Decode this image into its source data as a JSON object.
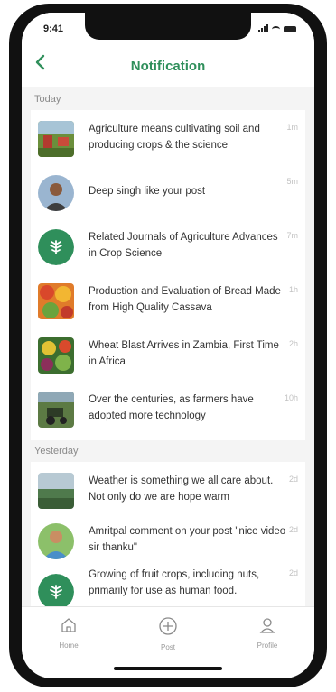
{
  "status_bar": {
    "time": "9:41"
  },
  "header": {
    "back_icon": "chevron-left-icon",
    "title": "Notification"
  },
  "sections": [
    {
      "label": "Today"
    },
    {
      "label": "Yesterday"
    }
  ],
  "notifications": [
    {
      "text": "Agriculture means cultivating soil and producing crops & the science",
      "time": "1m"
    },
    {
      "text": "Deep singh like your post",
      "time": "5m"
    },
    {
      "text": "Related Journals of Agriculture Advances in Crop Science",
      "time": "7m"
    },
    {
      "text": "Production and Evaluation of Bread Made from High Quality Cassava",
      "time": "1h"
    },
    {
      "text": "Wheat Blast Arrives in Zambia, First Time in Africa",
      "time": "2h"
    },
    {
      "text": "Over the centuries, as farmers have adopted more technology",
      "time": "10h"
    },
    {
      "text": "Weather is something we all care about. Not only do we are hope warm",
      "time": "2d"
    },
    {
      "text": "Amritpal comment on your post \"nice video sir thanku\"",
      "time": "2d"
    },
    {
      "text": "Growing of fruit crops, including nuts, primarily for use as human food.",
      "time": "2d"
    }
  ],
  "bottom_nav": [
    {
      "label": "Home",
      "icon": "home-icon"
    },
    {
      "label": "Post",
      "icon": "plus-circle-icon"
    },
    {
      "label": "Profile",
      "icon": "user-icon"
    }
  ],
  "colors": {
    "accent": "#2f8f5b",
    "background": "#f4f4f4"
  }
}
